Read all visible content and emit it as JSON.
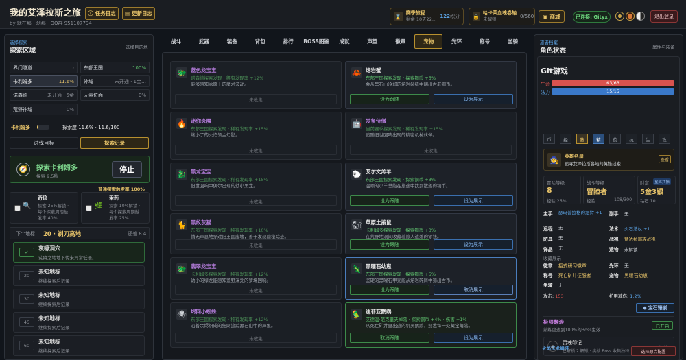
{
  "header": {
    "title": "我的艾泽拉斯之旅",
    "subtitle": "by 就在那一刹那 · QQ群 951107794",
    "task_log": "任务日志",
    "update_log": "更新日志",
    "season": {
      "label": "赛季旅程",
      "remaining": "剩余 10天22…",
      "points_value": "122",
      "points_unit": "积分"
    },
    "scroll": {
      "label": "哈卡莱血魂卷轴",
      "status": "未解锁",
      "count": "0/560"
    },
    "shop": "商城",
    "connected": "已连接: Gityx",
    "logout": "退出登录"
  },
  "left": {
    "section_tag": "选择探索",
    "section_title": "探索区域",
    "hint": "选择目的地",
    "zones": [
      {
        "name": "界门隧道",
        "value": "›"
      },
      {
        "name": "东部王国",
        "value": "100%"
      },
      {
        "name": "卡利姆多",
        "value": "11.6%"
      },
      {
        "name": "外域",
        "value": "未开通 · 1金…"
      },
      {
        "name": "诺森德",
        "value": "未开通 · 5金"
      },
      {
        "name": "元素位面",
        "value": "0%"
      },
      {
        "name": "荒野神域",
        "value": "0%"
      }
    ],
    "progress": {
      "zone": "卡利姆多",
      "text": "探索度 11.6% · 11.6/100",
      "fraction": 0.116
    },
    "tab_target": "讨伐目标",
    "tab_record": "探索记录",
    "exploring": {
      "title": "探索卡利姆多",
      "speed": "探索 9.5秒",
      "stop": "停止"
    },
    "trigger_rate": "普通探索触发率 100%",
    "rare": {
      "name": "奇珍",
      "line1": "探索 25%解锁 ·",
      "line2": "每个探索周期触",
      "line3": "发率 40%"
    },
    "herb": {
      "name": "采药",
      "line1": "探索 10%解锁 ·",
      "line2": "每个探索周期触",
      "line3": "发率 25%"
    },
    "next_label": "下个地标",
    "next_name": "20 · 剃刀高地",
    "next_left": "还差 8.4",
    "landmarks": [
      {
        "num": "✓",
        "name": "哀嚎洞穴",
        "desc": "贫瘠之地地下传来异常低语。"
      },
      {
        "num": "20",
        "name": "未知地标",
        "desc": "继续探索后记录"
      },
      {
        "num": "30",
        "name": "未知地标",
        "desc": "继续探索后记录"
      },
      {
        "num": "45",
        "name": "未知地标",
        "desc": "继续探索后记录"
      },
      {
        "num": "60",
        "name": "未知地标",
        "desc": "继续探索后记录"
      }
    ]
  },
  "tabs": [
    "战斗",
    "武器",
    "装备",
    "背包",
    "排行",
    "BOSS图鉴",
    "成就",
    "声望",
    "徽章",
    "宠物",
    "光环",
    "称号",
    "坐骑"
  ],
  "active_tab": "宠物",
  "pets": [
    {
      "name": "蓝色龙宝宝",
      "line1": "诺森德探索发现 · 稀有发现率 +12%",
      "line2": "能够感知冰原上的魔术波动。",
      "collected": false,
      "icon": "🐲"
    },
    {
      "name": "熔岩蟹",
      "line1": "东部王国探索发现 · 探索铜币 +5%",
      "line2": "会从黑石山冷却的熔岩裂缝中翻出古老铜币。",
      "collected": true,
      "icon": "🦀",
      "btn1": "设为跟随",
      "btn2": "设为展示"
    },
    {
      "name": "迷你炎魔",
      "line1": "东部王国探索发现 · 稀有发现率 +15%",
      "line2": "继小了的火焰领主幻影。",
      "collected": false,
      "icon": "🔥"
    },
    {
      "name": "发条侍僧",
      "line1": "当前赛季探索发现 · 稀有发现率 +15%",
      "line2": "追随旧世回响出现的精密机械伙伴。",
      "collected": false,
      "icon": "🤖"
    },
    {
      "name": "黑龙宝宝",
      "line1": "东部王国探索发现 · 稀有发现率 +15%",
      "line2": "但世回响中偶尔出现的幼小黑龙。",
      "collected": false,
      "icon": "🐉"
    },
    {
      "name": "艾尔文羔羊",
      "line1": "东部王国探索发现 · 探索铜币 +3%",
      "line2": "温顺的小羊总能在旅途中找到散落的铜币。",
      "collected": true,
      "icon": "🐑",
      "btn1": "设为跟随",
      "btn2": "设为展示"
    },
    {
      "name": "黑纹灰猫",
      "line1": "东部王国探索发现 · 稀有发现率 +10%",
      "line2": "悄无声息地穿过旧王国废墟，善于发现隐秘踪迹。",
      "collected": false,
      "icon": "🐈"
    },
    {
      "name": "草原土拨鼠",
      "line1": "卡利姆多探索发现 · 探索铜币 +3%",
      "line2": "在荒野地洞间收藏着旅人遗落的零钱。",
      "collected": true,
      "icon": "🐿",
      "btn1": "设为跟随",
      "btn2": "设为展示"
    },
    {
      "name": "翡翠龙宝宝",
      "line1": "卡利姆多探索发现 · 稀有发现率 +12%",
      "line2": "幼小的绿龙能感知荒野深处的梦境回响。",
      "collected": false,
      "icon": "🐲"
    },
    {
      "name": "黑曜石幼崽",
      "line1": "东部王国探索发现 · 探索铜币 +5%",
      "line2": "坚硬的黑曜石甲壳能从熔岩碎屑中筛出古币。",
      "collected": true,
      "icon": "🦎",
      "btn1": "设为跟随",
      "btn2": "取消展示",
      "focus": true
    },
    {
      "name": "烬网小蜘蛛",
      "line1": "东部王国探索发现 · 稀有发现率 +12%",
      "line2": "沿着余烬织成的细网追踪黑石山中的异象。",
      "collected": false,
      "icon": "🕷"
    },
    {
      "name": "迪菲亚鹦鹉",
      "line1": "艾德温·范克里夫掉落 · 探索铜币 +4% · 伤害 +1%",
      "line2": "从死亡矿井里出逃的机灵鹦鹉，熟悉每一处藏宝角落。",
      "collected": true,
      "icon": "🦜",
      "btn1": "取消跟随",
      "btn2": "设为展示",
      "display": true
    }
  ],
  "uncollected": "未收集",
  "right": {
    "section_tag": "旅者档案",
    "section_title": "角色状态",
    "hint": "属性与装备",
    "char_name": "Git游戏",
    "hp_label": "生命",
    "hp_text": "63/63",
    "hp_fraction": 1.0,
    "mp_label": "法力",
    "mp_text": "15/15",
    "mp_fraction": 1.0,
    "skills": [
      "币",
      "经",
      "熟",
      "精",
      "药",
      "抗",
      "生",
      "攻"
    ],
    "title_card": {
      "name": "英雄名册",
      "desc": "追寻艾泽拉斯各地的英雄线索",
      "btn": "查看"
    },
    "adv_label": "冒险等级",
    "adv_value": "8",
    "adv_exp": "经验 26%",
    "combat_label": "战斗等级",
    "combat_value": "冒险者",
    "combat_exp_label": "经验",
    "combat_exp": "108/300",
    "wealth_label": "财富",
    "wealth_badge": "星辉共振",
    "wealth_value": "5金3银",
    "wealth_sub": "钻石 10",
    "stats_left": [
      {
        "k": "主手",
        "v": "瑟玛普拉格的左臂 +1"
      },
      {
        "k": "远程",
        "v": "无"
      },
      {
        "k": "防具",
        "v": "无"
      },
      {
        "k": "饰品",
        "v": "无"
      }
    ],
    "stats_right": [
      {
        "k": "副手",
        "v": "无"
      },
      {
        "k": "法术",
        "v": "火石法杖 +1"
      },
      {
        "k": "战袍",
        "v": "赞达拉部族战袍"
      },
      {
        "k": "遗物",
        "v": "未解锁"
      }
    ],
    "collect_title": "收藏展示",
    "collect": [
      {
        "k": "徽章",
        "v": "招式研习徽章",
        "k2": "光环",
        "v2": "无"
      },
      {
        "k": "称号",
        "v": "死亡矿井征服者",
        "k2": "宠物",
        "v2": "黑曜石幼崽"
      },
      {
        "k": "坐骑",
        "v": "无",
        "k2": "",
        "v2": ""
      }
    ],
    "attack_label": "攻击:",
    "attack_value": "153",
    "armor_label": "护甲减伤:",
    "armor_value": "1.2%",
    "gem_btn": "宝石镶嵌",
    "extreme_title": "极限翻滚",
    "extreme_desc": "熟练度达到100%的Boss生效",
    "extreme_btn": "已开启",
    "soul_title": "灵魂印记",
    "soul_desc": "已解锁 2 解锁 · 挑战 Boss 收集独特…",
    "soul_status": "未解锁",
    "bottom_title": "火焰法术编排",
    "bottom_btn": "选择原点配置"
  }
}
